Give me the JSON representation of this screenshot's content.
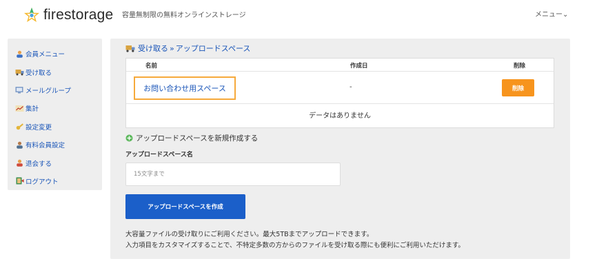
{
  "header": {
    "logo_text": "firestorage",
    "tagline": "容量無制限の無料オンラインストレージ",
    "menu_label": "メニュー⌄"
  },
  "sidebar": {
    "items": [
      {
        "label": "会員メニュー",
        "icon": "user-icon"
      },
      {
        "label": "受け取る",
        "icon": "truck-icon"
      },
      {
        "label": "メールグループ",
        "icon": "mail-group-icon"
      },
      {
        "label": "集計",
        "icon": "chart-icon"
      },
      {
        "label": "設定変更",
        "icon": "key-icon"
      },
      {
        "label": "有料会員設定",
        "icon": "member-icon"
      },
      {
        "label": "退会する",
        "icon": "user-leave-icon"
      },
      {
        "label": "ログアウト",
        "icon": "logout-icon"
      }
    ]
  },
  "breadcrumb": {
    "parent": "受け取る",
    "separator": "»",
    "current": "アップロードスペース"
  },
  "table": {
    "headers": {
      "name": "名前",
      "created": "作成日",
      "delete": "削除"
    },
    "rows": [
      {
        "name": "お問い合わせ用スペース",
        "created": "-",
        "delete_label": "削除"
      }
    ],
    "empty_message": "データはありません"
  },
  "create_form": {
    "link_label": "アップロードスペースを新規作成する",
    "field_label": "アップロードスペース名",
    "placeholder": "15文字まで",
    "value": "",
    "submit_label": "アップロードスペースを作成"
  },
  "description": {
    "line1": "大容量ファイルの受け取りにご利用ください。最大5TBまでアップロードできます。",
    "line2": "入力項目をカスタマイズすることで、不特定多数の方からのファイルを受け取る際にも便利にご利用いただけます。"
  },
  "colors": {
    "link": "#1a55b8",
    "accent_orange": "#f7941d",
    "highlight_border": "#f6a93b",
    "primary_button": "#1b5fc9",
    "panel_bg": "#eeeeee"
  }
}
